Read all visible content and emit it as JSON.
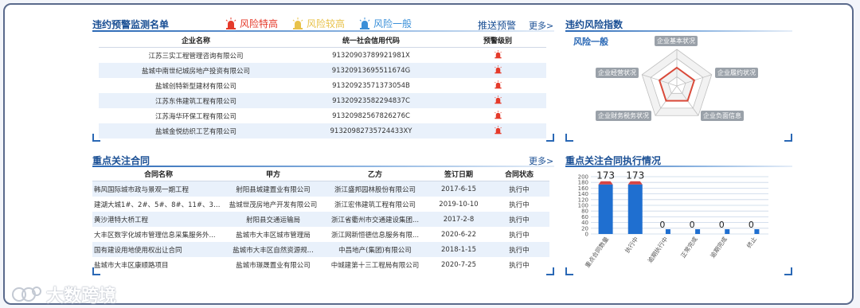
{
  "colors": {
    "high": "#e53a2a",
    "mid": "#e8c24a",
    "low": "#3a8fd8",
    "title": "#1a4f94",
    "bar_red": "#d64545",
    "bar_blue": "#1f6fd0"
  },
  "warning_list": {
    "title": "违约预警监测名单",
    "legend": [
      {
        "label": "风险特高",
        "color": "#e53a2a",
        "icon": "siren-icon"
      },
      {
        "label": "风险较高",
        "color": "#e8c24a",
        "icon": "siren-icon"
      },
      {
        "label": "风险一般",
        "color": "#3a8fd8",
        "icon": "siren-icon"
      }
    ],
    "push_label": "推送预警",
    "more_label": "更多>",
    "columns": [
      "企业名称",
      "统一社会信用代码",
      "预警级别"
    ],
    "rows": [
      {
        "name": "江苏三实工程管理咨询有限公司",
        "code": "91320903789921981X"
      },
      {
        "name": "盐城中南世纪城房地产投资有限公司",
        "code": "91320913695511674G"
      },
      {
        "name": "盐城创特新型建材有限公司",
        "code": "91320923571373054B"
      },
      {
        "name": "江苏东伟建筑工程有限公司",
        "code": "91320923582294837C"
      },
      {
        "name": "江苏海华环保工程有限公司",
        "code": "91320982567826276C"
      },
      {
        "name": "盐城金悦纺织工艺有限公司",
        "code": "91320982735724433XY"
      }
    ]
  },
  "risk_index": {
    "title": "违约风险指数",
    "level": "风险一般",
    "axes": [
      "企业基本状况",
      "企业履约状况",
      "企业负面信息",
      "企业财务税务状况",
      "企业经营状况"
    ]
  },
  "contracts": {
    "title": "重点关注合同",
    "more_label": "更多>",
    "columns": [
      "合同名称",
      "甲方",
      "乙方",
      "签订日期",
      "合同状态"
    ],
    "rows": [
      {
        "name": "韩风国际城市政与景观一期工程",
        "a": "射阳县城建置业有限公司",
        "b": "浙江盛邦园林股份有限公司",
        "date": "2017-6-15",
        "status": "执行中"
      },
      {
        "name": "建湖大城1#、2#、5#、8#、11#、32#...",
        "a": "盐城世茂房地产开发有限公司",
        "b": "浙江宏伟建筑工程有限公司",
        "date": "2019-10-10",
        "status": "执行中"
      },
      {
        "name": "黄沙港特大桥工程",
        "a": "射阳县交通运输局",
        "b": "浙江省衢州市交通建设集团...",
        "date": "2017-2-8",
        "status": "执行中"
      },
      {
        "name": "大丰区数字化城市管理信息采集服务外...",
        "a": "盐城市大丰区城市管理局",
        "b": "浙江网新恒德信息服务有限...",
        "date": "2020-6-22",
        "status": "执行中"
      },
      {
        "name": "国有建设用地使用权出让合同",
        "a": "盐城市大丰区自然资源规...",
        "b": "中昌地产(集团)有限公司",
        "date": "2018-1-15",
        "status": "执行中"
      },
      {
        "name": "盐城市大丰区康顺路项目",
        "a": "盐城市璟晟置业有限公司",
        "b": "中城建第十三工程局有限公司",
        "date": "2020-7-25",
        "status": "执行中"
      }
    ]
  },
  "execution": {
    "title": "重点关注合同执行情况",
    "chart_data": {
      "type": "bar",
      "categories": [
        "重点合同数量",
        "执行中",
        "逾期执行中",
        "正常完成",
        "逾期完成",
        "终止"
      ],
      "values": [
        173,
        173,
        0,
        0,
        0,
        0
      ],
      "ylim": [
        0,
        200
      ],
      "yticks": [
        0,
        20,
        40,
        60,
        80,
        100,
        120,
        140,
        160,
        180,
        200
      ]
    }
  },
  "watermark": "大数跨境"
}
